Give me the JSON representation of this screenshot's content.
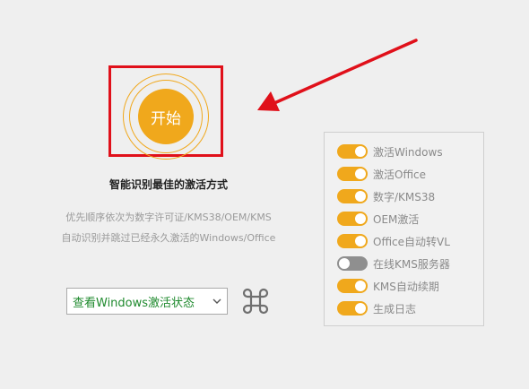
{
  "start": {
    "label": "开始"
  },
  "headline": "智能识别最佳的激活方式",
  "description": {
    "line1": "优先顺序依次为数字许可证/KMS38/OEM/KMS",
    "line2": "自动识别并跳过已经永久激活的Windows/Office"
  },
  "status_select": {
    "selected": "查看Windows激活状态"
  },
  "options": [
    {
      "label": "激活Windows",
      "on": true
    },
    {
      "label": "激活Office",
      "on": true
    },
    {
      "label": "数字/KMS38",
      "on": true
    },
    {
      "label": "OEM激活",
      "on": true
    },
    {
      "label": "Office自动转VL",
      "on": true
    },
    {
      "label": "在线KMS服务器",
      "on": false
    },
    {
      "label": "KMS自动续期",
      "on": true
    },
    {
      "label": "生成日志",
      "on": true
    }
  ],
  "colors": {
    "accent": "#f0a81c",
    "highlight": "#e0101a",
    "select_text": "#1f8a2e",
    "toggle_off": "#8f8f8f"
  },
  "icons": {
    "start_button": "circle-button",
    "arrow": "red-arrow-pointer",
    "select": "chevron-down-icon",
    "cmd": "command-key-icon"
  }
}
